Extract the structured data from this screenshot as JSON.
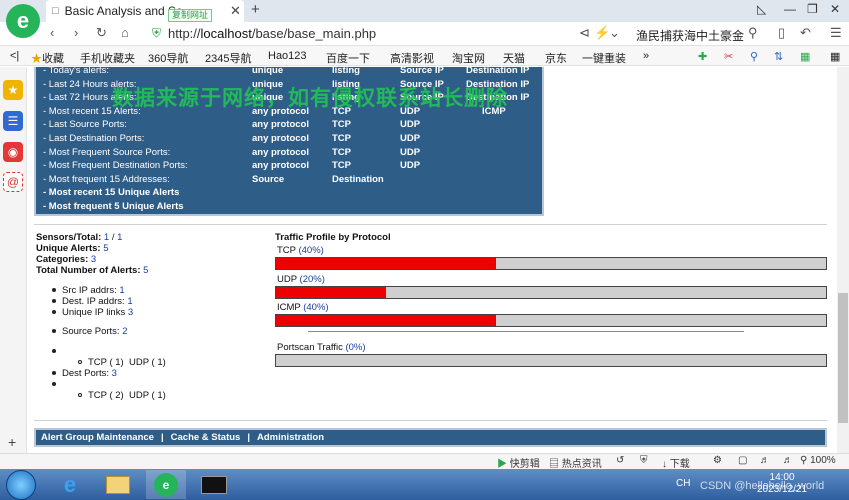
{
  "browser": {
    "tab_title": "Basic Analysis and Se...",
    "copy_badge": "复制网址",
    "url_prefix": "http://",
    "url_host": "localhost",
    "url_path": "/base/base_main.php",
    "ad_text": "渔民捕获海中土豪金",
    "bookmarks": [
      "收藏",
      "手机收藏夹",
      "360导航",
      "2345导航",
      "Hao123",
      "百度一下",
      "高清影视",
      "淘宝网",
      "天猫",
      "京东",
      "一键重装"
    ],
    "more": "»"
  },
  "alert_table": {
    "rows": [
      {
        "label": "- Today's alerts:",
        "bold": false,
        "c1": "unique",
        "c2": "listing",
        "c3": "Source IP",
        "c4": "Destination IP"
      },
      {
        "label": "- Last 24 Hours alerts:",
        "bold": false,
        "c1": "unique",
        "c2": "listing",
        "c3": "Source IP",
        "c4": "Destination IP"
      },
      {
        "label": "- Last 72 Hours alerts:",
        "bold": false,
        "c1": "unique",
        "c2": "listing",
        "c3": "Source IP",
        "c4": "Destination IP"
      },
      {
        "label": "- Most recent 15 Alerts:",
        "bold": false,
        "c1": "any protocol",
        "c2": "TCP",
        "c3": "UDP",
        "c4": "ICMP"
      },
      {
        "label": "- Last Source Ports:",
        "bold": false,
        "c1": "any protocol",
        "c2": "TCP",
        "c3": "UDP",
        "c4": ""
      },
      {
        "label": "- Last Destination Ports:",
        "bold": false,
        "c1": "any protocol",
        "c2": "TCP",
        "c3": "UDP",
        "c4": ""
      },
      {
        "label": "- Most Frequent Source Ports:",
        "bold": false,
        "c1": "any protocol",
        "c2": "TCP",
        "c3": "UDP",
        "c4": ""
      },
      {
        "label": "- Most Frequent Destination Ports:",
        "bold": false,
        "c1": "any protocol",
        "c2": "TCP",
        "c3": "UDP",
        "c4": ""
      },
      {
        "label": "- Most frequent 15 Addresses:",
        "bold": false,
        "c1": "Source",
        "c2": "Destination",
        "c3": "",
        "c4": ""
      },
      {
        "label": "- Most recent 15 Unique Alerts",
        "bold": true,
        "c1": "",
        "c2": "",
        "c3": "",
        "c4": ""
      },
      {
        "label": "- Most frequent 5 Unique Alerts",
        "bold": true,
        "c1": "",
        "c2": "",
        "c3": "",
        "c4": ""
      }
    ]
  },
  "watermark": "数据来源于网络，如有侵权联系站长删除",
  "stats": {
    "sensors_label": "Sensors/Total:",
    "sensors_value": "1",
    "sensors_sep": " / ",
    "sensors_total": "1",
    "unique_label": "Unique Alerts:",
    "unique_value": "5",
    "categories_label": "Categories:",
    "categories_value": "3",
    "total_label": "Total Number of Alerts:",
    "total_value": "5",
    "src_ip_label": "Src IP addrs:",
    "src_ip_value": "1",
    "dst_ip_label": "Dest. IP addrs:",
    "dst_ip_value": "1",
    "unique_links_label": "Unique IP links",
    "unique_links_value": "3",
    "source_ports_label": "Source Ports:",
    "source_ports_value": "2",
    "src_tcp": "TCP ( 1)",
    "src_udp": "UDP ( 1)",
    "dest_ports_label": "Dest Ports:",
    "dest_ports_value": "3",
    "dst_tcp": "TCP ( 2)",
    "dst_udp": "UDP ( 1)"
  },
  "traffic": {
    "title": "Traffic Profile by Protocol",
    "protocols": [
      {
        "name": "TCP",
        "pct_text": "(40%)",
        "percent": 40
      },
      {
        "name": "UDP",
        "pct_text": "(20%)",
        "percent": 20
      },
      {
        "name": "ICMP",
        "pct_text": "(40%)",
        "percent": 40
      }
    ],
    "portscan_label": "Portscan Traffic",
    "portscan_pct_text": "(0%)",
    "portscan_percent": 0
  },
  "footer_links": [
    "Alert Group Maintenance",
    "Cache & Status",
    "Administration"
  ],
  "footer_sep": "|",
  "statusbar": {
    "quick_clip": "快剪辑",
    "hot_news": "热点资讯",
    "download": "下载",
    "zoom": "100%"
  },
  "taskbar": {
    "time": "14:00",
    "date": "2023/12/21",
    "lang": "CH",
    "watermark_csdn": "CSDN @hellohello_world"
  },
  "colors": {
    "table_bg": "#2e5d88",
    "bar_fill": "#ee0000",
    "value_blue": "#1a3e9a"
  }
}
